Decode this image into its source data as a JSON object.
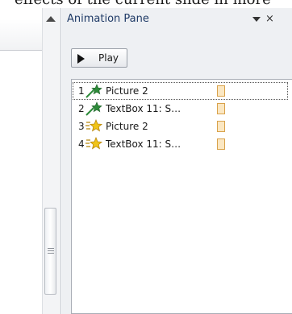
{
  "slide_text": "effects of the current slide in more",
  "pane": {
    "title": "Animation Pane",
    "close_glyph": "×",
    "play_label": "Play"
  },
  "animations": [
    {
      "number": "1",
      "effect": "entrance",
      "icon": "entrance-star-icon",
      "name": "Picture 2",
      "selected": true
    },
    {
      "number": "2",
      "effect": "entrance",
      "icon": "entrance-star-icon",
      "name": "TextBox 11: S…",
      "selected": false
    },
    {
      "number": "3",
      "effect": "emphasis",
      "icon": "emphasis-star-icon",
      "name": "Picture 2",
      "selected": false
    },
    {
      "number": "4",
      "effect": "emphasis",
      "icon": "emphasis-star-icon",
      "name": "TextBox 11: S…",
      "selected": false
    }
  ],
  "colors": {
    "entrance_star": "#2e8b3a",
    "emphasis_star": "#e3b51a",
    "timing_bar": "#fbe7c2"
  }
}
